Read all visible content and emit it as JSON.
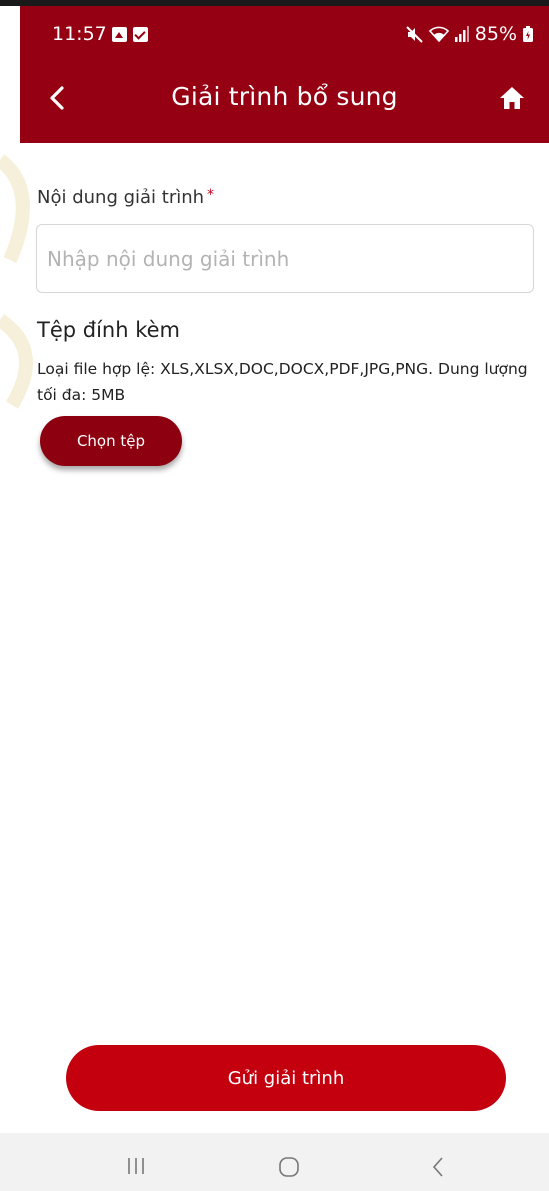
{
  "status_bar": {
    "time": "11:57",
    "battery": "85%"
  },
  "header": {
    "title": "Giải trình bổ sung",
    "back_icon": "chevron-left-icon",
    "home_icon": "home-icon",
    "background_color": "#950012"
  },
  "form": {
    "explanation_label": "Nội dung giải trình",
    "required_mark": "*",
    "explanation_value": "",
    "explanation_placeholder": "Nhập nội dung giải trình",
    "attachment_title": "Tệp đính kèm",
    "attachment_hint": "Loại file hợp lệ: XLS,XLSX,DOC,DOCX,PDF,JPG,PNG. Dung lượng tối đa: 5MB",
    "choose_file_label": "Chọn tệp"
  },
  "footer": {
    "submit_label": "Gửi giải trình",
    "submit_color": "#c4000f"
  },
  "system_nav": {
    "recent_icon": "recent-apps-icon",
    "home_icon": "home-circle-icon",
    "back_icon": "back-icon"
  }
}
